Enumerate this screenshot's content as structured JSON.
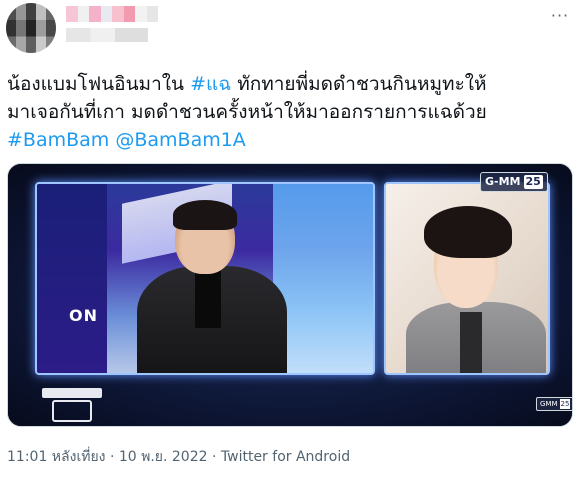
{
  "author": {
    "avatar_icon": "profile-avatar-pixelated",
    "name_blur_colors": [
      "#f6c6d6",
      "#f0f0f0",
      "#f5b1c9",
      "#e9e9f1",
      "#f6c0cf",
      "#f29aaf",
      "#f2f2f2",
      "#e6e6e6"
    ]
  },
  "header": {
    "more_icon": "more-horizontal-icon",
    "more_label": "···"
  },
  "tweet": {
    "text_line1_prefix": "น้องแบมโฟนอินมาใน ",
    "hashtag_1": "#แฉ",
    "text_line1_suffix": " ทักทายพี่มดดำชวนกินหมูทะให้",
    "text_line2": "มาเจอกันที่เกา มดดำชวนครั้งหน้าให้มาออกรายการแฉด้วย",
    "hashtag_2": "#BamBam",
    "mention": "@BamBam1A"
  },
  "media": {
    "studio_text": "ON",
    "channel_logo_text": "G-MM",
    "channel_logo_num": "25",
    "small_logo_text": "GMM",
    "small_logo_num": "25"
  },
  "meta": {
    "timestamp": "11:01 หลังเที่ยง · 10 พ.ย. 2022",
    "separator": " · ",
    "client": "Twitter for Android"
  },
  "colors": {
    "link": "#1d9bf0",
    "text": "#0f1419",
    "secondary": "#536471",
    "border": "#cfd9de"
  }
}
